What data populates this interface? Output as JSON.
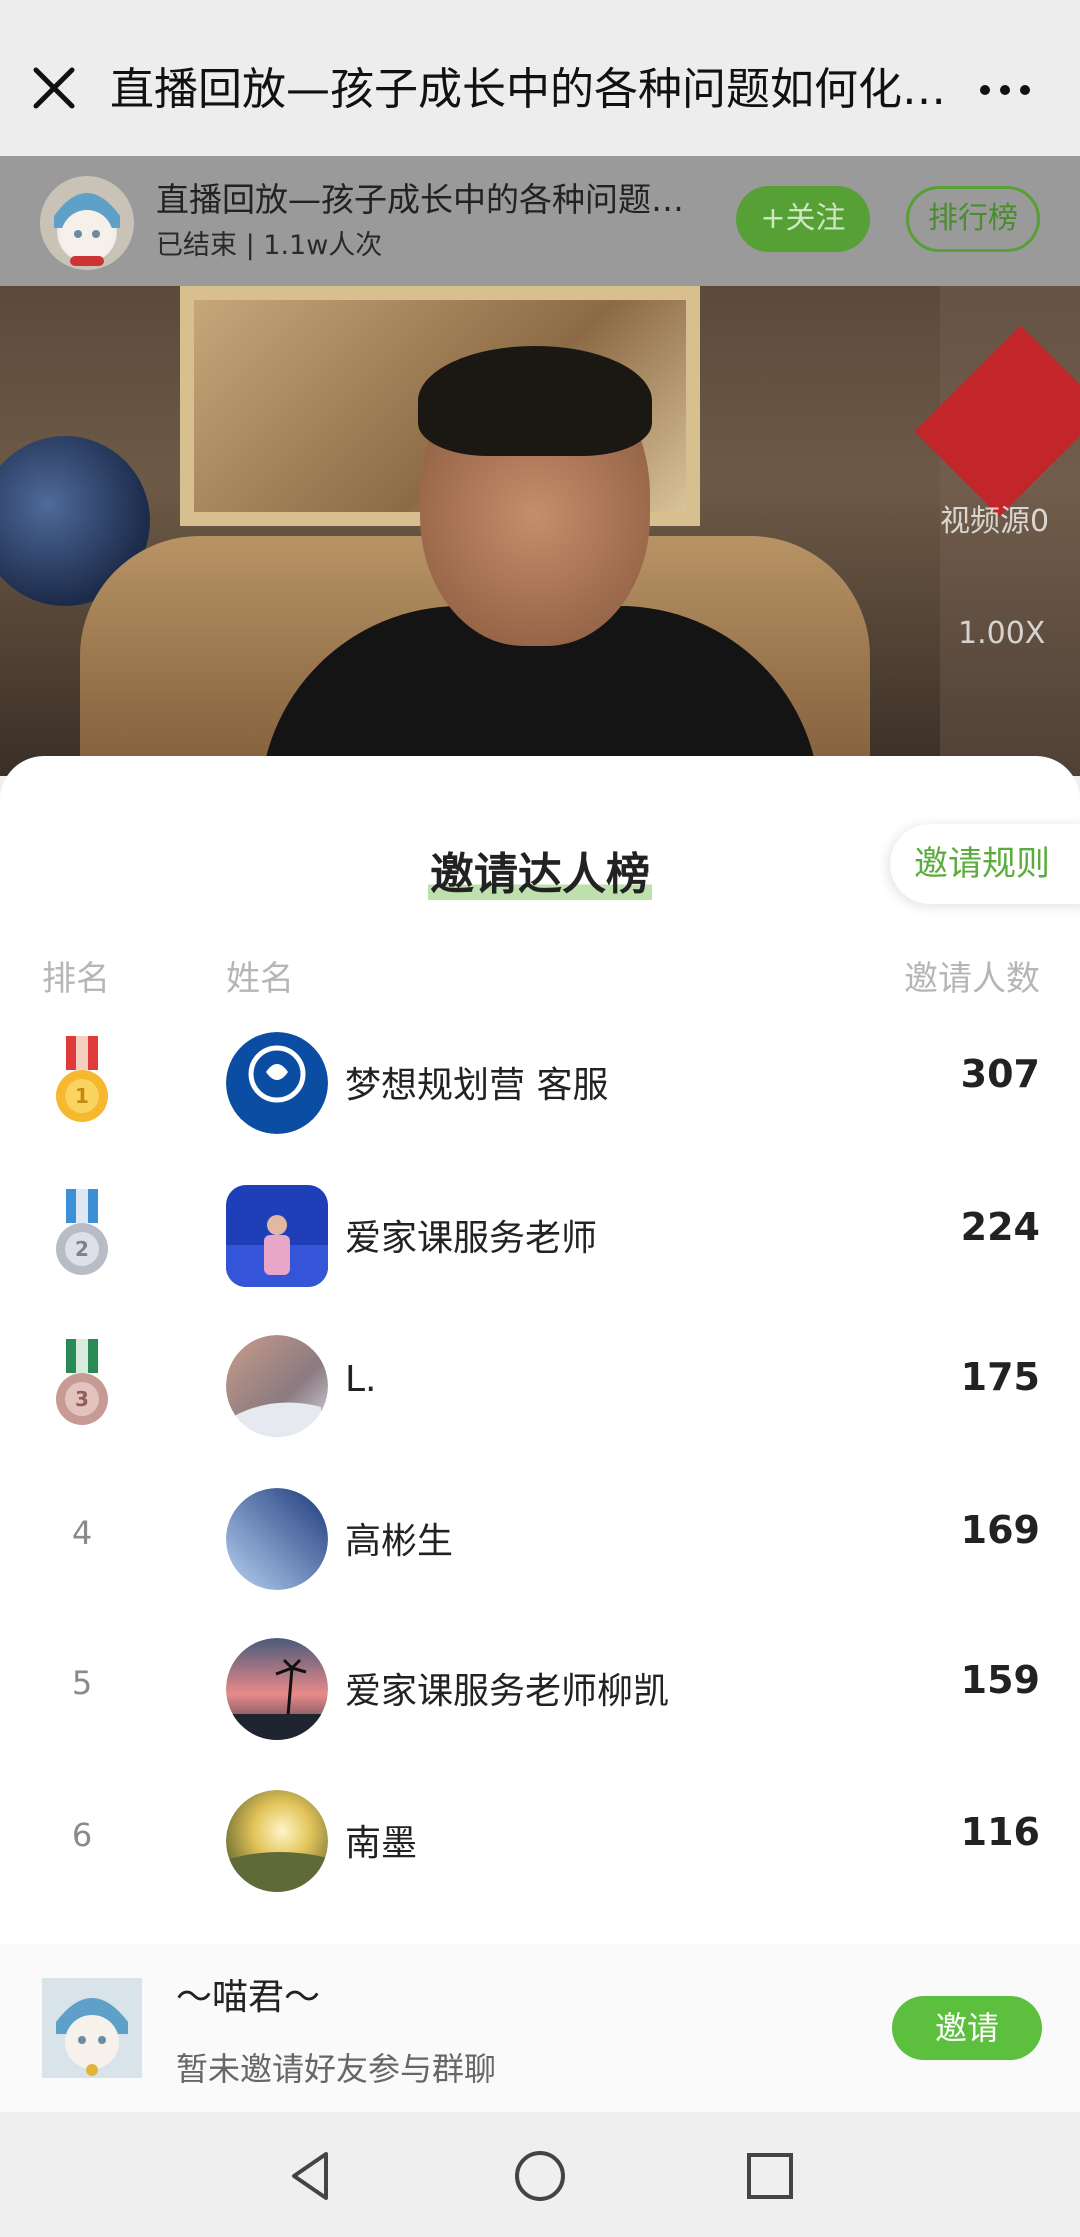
{
  "titlebar": {
    "title": "直播回放—孩子成长中的各种问题如何化…",
    "close_icon": "close-icon",
    "more_icon": "more-icon"
  },
  "live": {
    "title": "直播回放—孩子成长中的各种问题…",
    "status": "已结束 | 1.1w人次",
    "follow_label": "+关注",
    "rank_label": "排行榜"
  },
  "video": {
    "source_label": "视频源0",
    "speed_label": "1.00X"
  },
  "leaderboard": {
    "title": "邀请达人榜",
    "rules_label": "邀请规则",
    "headers": {
      "rank": "排名",
      "name": "姓名",
      "count": "邀请人数"
    },
    "rows": [
      {
        "rank": "1",
        "name": "梦想规划营 客服",
        "count": "307",
        "medal": "gold"
      },
      {
        "rank": "2",
        "name": "爱家课服务老师",
        "count": "224",
        "medal": "silver"
      },
      {
        "rank": "3",
        "name": "L.",
        "count": "175",
        "medal": "bronze"
      },
      {
        "rank": "4",
        "name": "高彬生",
        "count": "169"
      },
      {
        "rank": "5",
        "name": "爱家课服务老师柳凯",
        "count": "159"
      },
      {
        "rank": "6",
        "name": "南墨",
        "count": "116"
      }
    ]
  },
  "me": {
    "name": "～喵君～",
    "status": "暂未邀请好友参与群聊",
    "invite_label": "邀请"
  },
  "colors": {
    "accent_green": "#5cbf3d",
    "dark_green": "#56a036"
  }
}
